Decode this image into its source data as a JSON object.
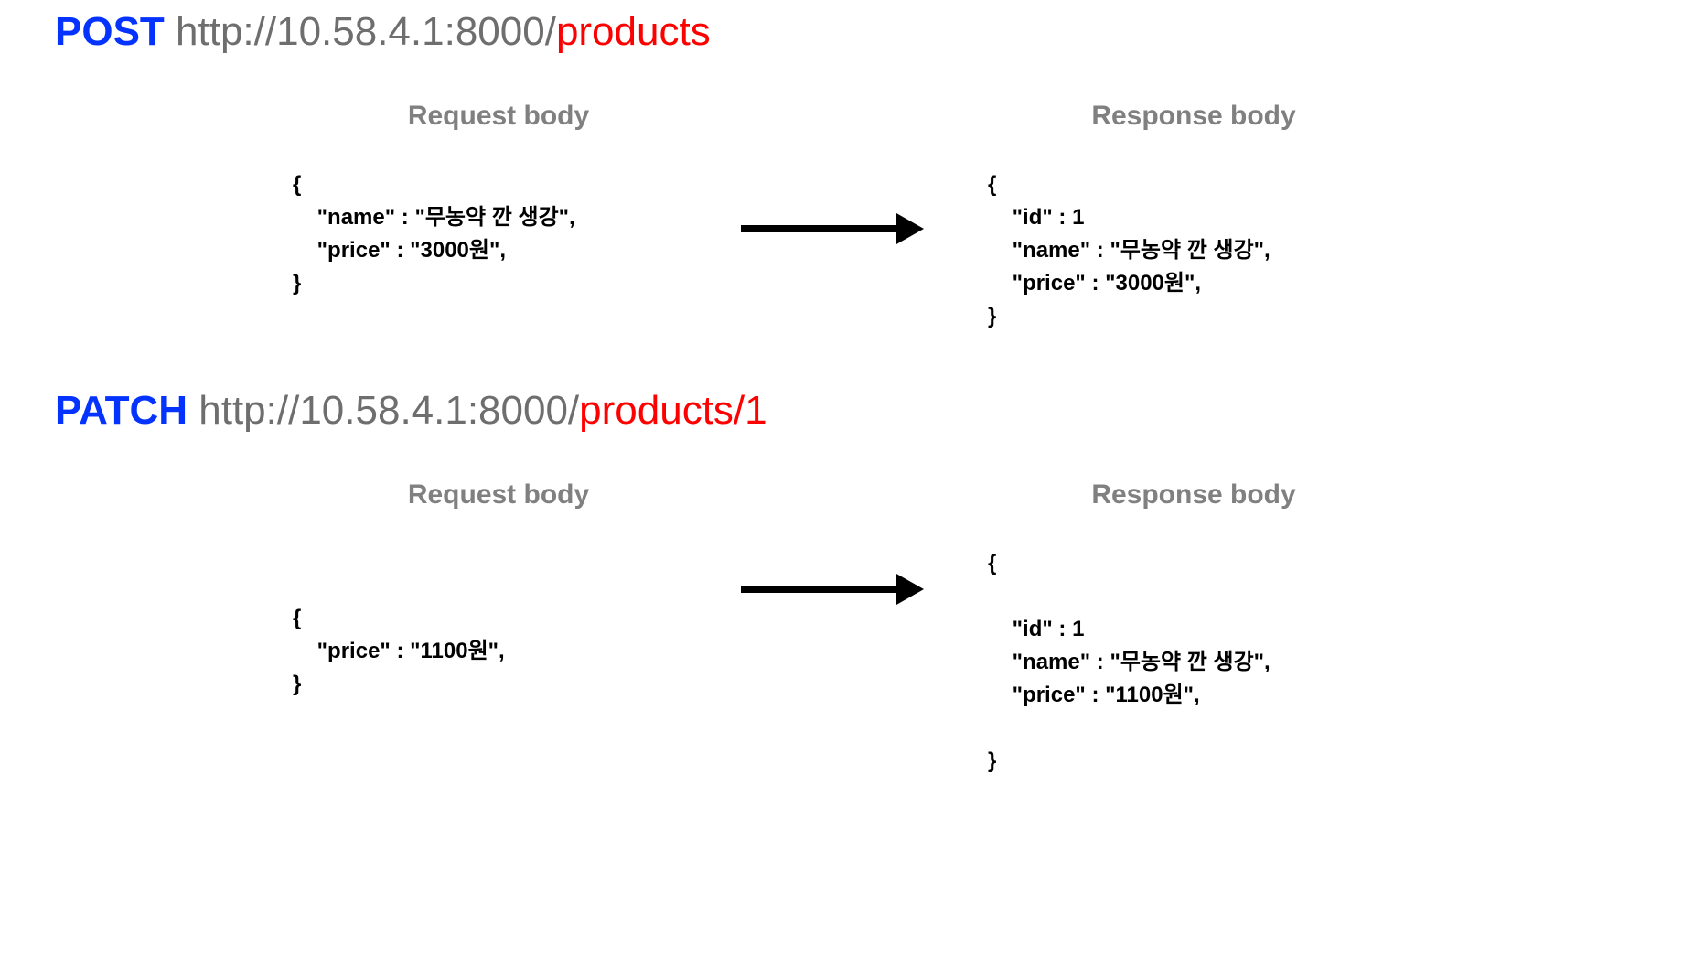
{
  "post": {
    "method": "POST",
    "url_base": "http://10.58.4.1:8000/",
    "url_path": "products",
    "request_label": "Request body",
    "response_label": "Response body",
    "request_body": "{\n    \"name\" : \"무농약 깐 생강\",\n    \"price\" : \"3000원\",\n}",
    "response_body": "{\n    \"id\" : 1\n    \"name\" : \"무농약 깐 생강\",\n    \"price\" : \"3000원\",\n}"
  },
  "patch": {
    "method": "PATCH",
    "url_base": "http://10.58.4.1:8000/",
    "url_path": "products/1",
    "request_label": "Request body",
    "response_label": "Response body",
    "request_body": "{\n    \"price\" : \"1100원\",\n}",
    "response_body": "{\n\n    \"id\" : 1\n    \"name\" : \"무농약 깐 생강\",\n    \"price\" : \"1100원\",\n\n}"
  }
}
